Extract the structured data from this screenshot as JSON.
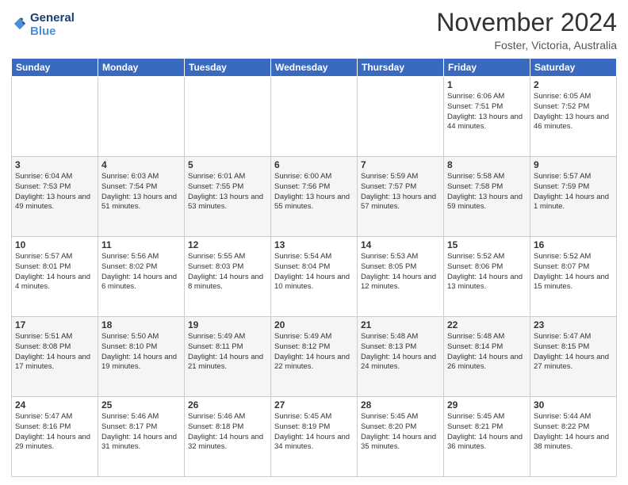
{
  "logo": {
    "line1": "General",
    "line2": "Blue"
  },
  "title": "November 2024",
  "location": "Foster, Victoria, Australia",
  "headers": [
    "Sunday",
    "Monday",
    "Tuesday",
    "Wednesday",
    "Thursday",
    "Friday",
    "Saturday"
  ],
  "weeks": [
    [
      {
        "day": "",
        "info": ""
      },
      {
        "day": "",
        "info": ""
      },
      {
        "day": "",
        "info": ""
      },
      {
        "day": "",
        "info": ""
      },
      {
        "day": "",
        "info": ""
      },
      {
        "day": "1",
        "info": "Sunrise: 6:06 AM\nSunset: 7:51 PM\nDaylight: 13 hours\nand 44 minutes."
      },
      {
        "day": "2",
        "info": "Sunrise: 6:05 AM\nSunset: 7:52 PM\nDaylight: 13 hours\nand 46 minutes."
      }
    ],
    [
      {
        "day": "3",
        "info": "Sunrise: 6:04 AM\nSunset: 7:53 PM\nDaylight: 13 hours\nand 49 minutes."
      },
      {
        "day": "4",
        "info": "Sunrise: 6:03 AM\nSunset: 7:54 PM\nDaylight: 13 hours\nand 51 minutes."
      },
      {
        "day": "5",
        "info": "Sunrise: 6:01 AM\nSunset: 7:55 PM\nDaylight: 13 hours\nand 53 minutes."
      },
      {
        "day": "6",
        "info": "Sunrise: 6:00 AM\nSunset: 7:56 PM\nDaylight: 13 hours\nand 55 minutes."
      },
      {
        "day": "7",
        "info": "Sunrise: 5:59 AM\nSunset: 7:57 PM\nDaylight: 13 hours\nand 57 minutes."
      },
      {
        "day": "8",
        "info": "Sunrise: 5:58 AM\nSunset: 7:58 PM\nDaylight: 13 hours\nand 59 minutes."
      },
      {
        "day": "9",
        "info": "Sunrise: 5:57 AM\nSunset: 7:59 PM\nDaylight: 14 hours\nand 1 minute."
      }
    ],
    [
      {
        "day": "10",
        "info": "Sunrise: 5:57 AM\nSunset: 8:01 PM\nDaylight: 14 hours\nand 4 minutes."
      },
      {
        "day": "11",
        "info": "Sunrise: 5:56 AM\nSunset: 8:02 PM\nDaylight: 14 hours\nand 6 minutes."
      },
      {
        "day": "12",
        "info": "Sunrise: 5:55 AM\nSunset: 8:03 PM\nDaylight: 14 hours\nand 8 minutes."
      },
      {
        "day": "13",
        "info": "Sunrise: 5:54 AM\nSunset: 8:04 PM\nDaylight: 14 hours\nand 10 minutes."
      },
      {
        "day": "14",
        "info": "Sunrise: 5:53 AM\nSunset: 8:05 PM\nDaylight: 14 hours\nand 12 minutes."
      },
      {
        "day": "15",
        "info": "Sunrise: 5:52 AM\nSunset: 8:06 PM\nDaylight: 14 hours\nand 13 minutes."
      },
      {
        "day": "16",
        "info": "Sunrise: 5:52 AM\nSunset: 8:07 PM\nDaylight: 14 hours\nand 15 minutes."
      }
    ],
    [
      {
        "day": "17",
        "info": "Sunrise: 5:51 AM\nSunset: 8:08 PM\nDaylight: 14 hours\nand 17 minutes."
      },
      {
        "day": "18",
        "info": "Sunrise: 5:50 AM\nSunset: 8:10 PM\nDaylight: 14 hours\nand 19 minutes."
      },
      {
        "day": "19",
        "info": "Sunrise: 5:49 AM\nSunset: 8:11 PM\nDaylight: 14 hours\nand 21 minutes."
      },
      {
        "day": "20",
        "info": "Sunrise: 5:49 AM\nSunset: 8:12 PM\nDaylight: 14 hours\nand 22 minutes."
      },
      {
        "day": "21",
        "info": "Sunrise: 5:48 AM\nSunset: 8:13 PM\nDaylight: 14 hours\nand 24 minutes."
      },
      {
        "day": "22",
        "info": "Sunrise: 5:48 AM\nSunset: 8:14 PM\nDaylight: 14 hours\nand 26 minutes."
      },
      {
        "day": "23",
        "info": "Sunrise: 5:47 AM\nSunset: 8:15 PM\nDaylight: 14 hours\nand 27 minutes."
      }
    ],
    [
      {
        "day": "24",
        "info": "Sunrise: 5:47 AM\nSunset: 8:16 PM\nDaylight: 14 hours\nand 29 minutes."
      },
      {
        "day": "25",
        "info": "Sunrise: 5:46 AM\nSunset: 8:17 PM\nDaylight: 14 hours\nand 31 minutes."
      },
      {
        "day": "26",
        "info": "Sunrise: 5:46 AM\nSunset: 8:18 PM\nDaylight: 14 hours\nand 32 minutes."
      },
      {
        "day": "27",
        "info": "Sunrise: 5:45 AM\nSunset: 8:19 PM\nDaylight: 14 hours\nand 34 minutes."
      },
      {
        "day": "28",
        "info": "Sunrise: 5:45 AM\nSunset: 8:20 PM\nDaylight: 14 hours\nand 35 minutes."
      },
      {
        "day": "29",
        "info": "Sunrise: 5:45 AM\nSunset: 8:21 PM\nDaylight: 14 hours\nand 36 minutes."
      },
      {
        "day": "30",
        "info": "Sunrise: 5:44 AM\nSunset: 8:22 PM\nDaylight: 14 hours\nand 38 minutes."
      }
    ]
  ]
}
